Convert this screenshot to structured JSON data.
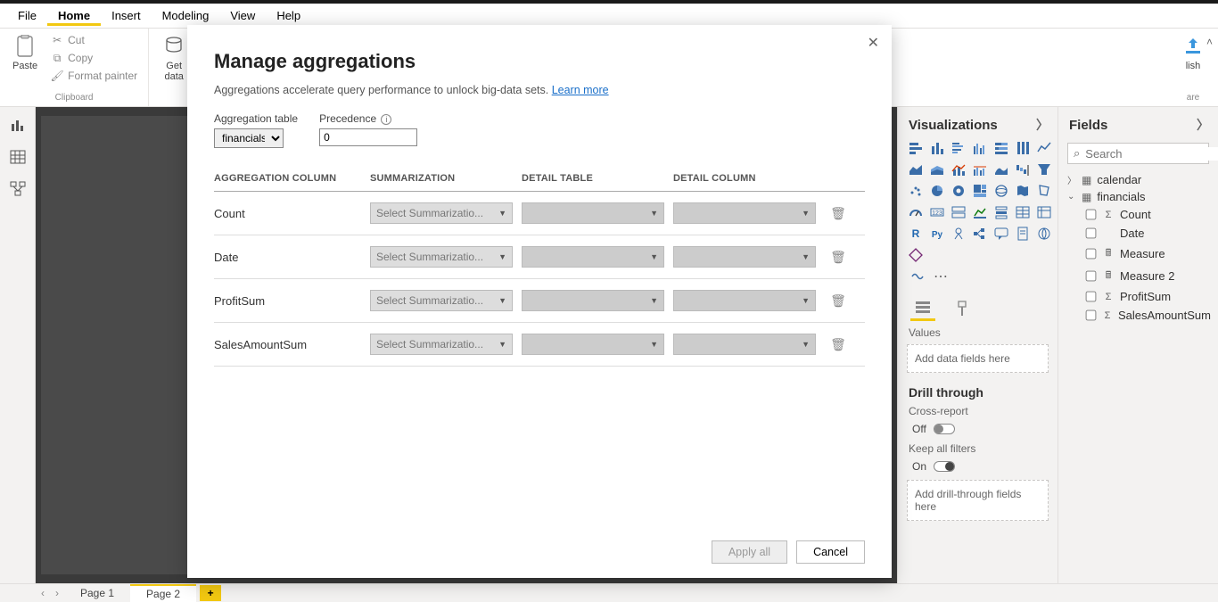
{
  "menu": {
    "items": [
      "File",
      "Home",
      "Insert",
      "Modeling",
      "View",
      "Help"
    ],
    "active": 1
  },
  "ribbon": {
    "paste": "Paste",
    "cut": "Cut",
    "copy": "Copy",
    "format_painter": "Format painter",
    "clipboard_label": "Clipboard",
    "get_data": "Get\ndata",
    "publish_partial": "lish",
    "share_partial": "are"
  },
  "views": [
    "report",
    "data",
    "model"
  ],
  "pages": {
    "items": [
      "Page 1",
      "Page 2"
    ],
    "active": 1
  },
  "viz_panel": {
    "title": "Visualizations",
    "values_label": "Values",
    "values_placeholder": "Add data fields here",
    "drill_title": "Drill through",
    "cross_report": "Cross-report",
    "cross_state": "Off",
    "keep_filters": "Keep all filters",
    "keep_state": "On",
    "drill_placeholder": "Add drill-through fields here"
  },
  "fields_panel": {
    "title": "Fields",
    "search_placeholder": "Search",
    "tables": [
      {
        "name": "calendar",
        "expanded": false
      },
      {
        "name": "financials",
        "expanded": true,
        "fields": [
          {
            "name": "Count",
            "icon": "sigma"
          },
          {
            "name": "Date",
            "icon": ""
          },
          {
            "name": "Measure",
            "icon": "calc"
          },
          {
            "name": "Measure 2",
            "icon": "calc"
          },
          {
            "name": "ProfitSum",
            "icon": "sigma"
          },
          {
            "name": "SalesAmountSum",
            "icon": "sigma"
          }
        ]
      }
    ]
  },
  "dialog": {
    "title": "Manage aggregations",
    "desc": "Aggregations accelerate query performance to unlock big-data sets. ",
    "learn_more": "Learn more",
    "agg_table_label": "Aggregation table",
    "agg_table_value": "financials",
    "precedence_label": "Precedence",
    "precedence_value": "0",
    "headers": [
      "AGGREGATION COLUMN",
      "SUMMARIZATION",
      "DETAIL TABLE",
      "DETAIL COLUMN"
    ],
    "rows": [
      {
        "col": "Count",
        "summ": "Select Summarizatio..."
      },
      {
        "col": "Date",
        "summ": "Select Summarizatio..."
      },
      {
        "col": "ProfitSum",
        "summ": "Select Summarizatio..."
      },
      {
        "col": "SalesAmountSum",
        "summ": "Select Summarizatio..."
      }
    ],
    "apply": "Apply all",
    "cancel": "Cancel"
  }
}
